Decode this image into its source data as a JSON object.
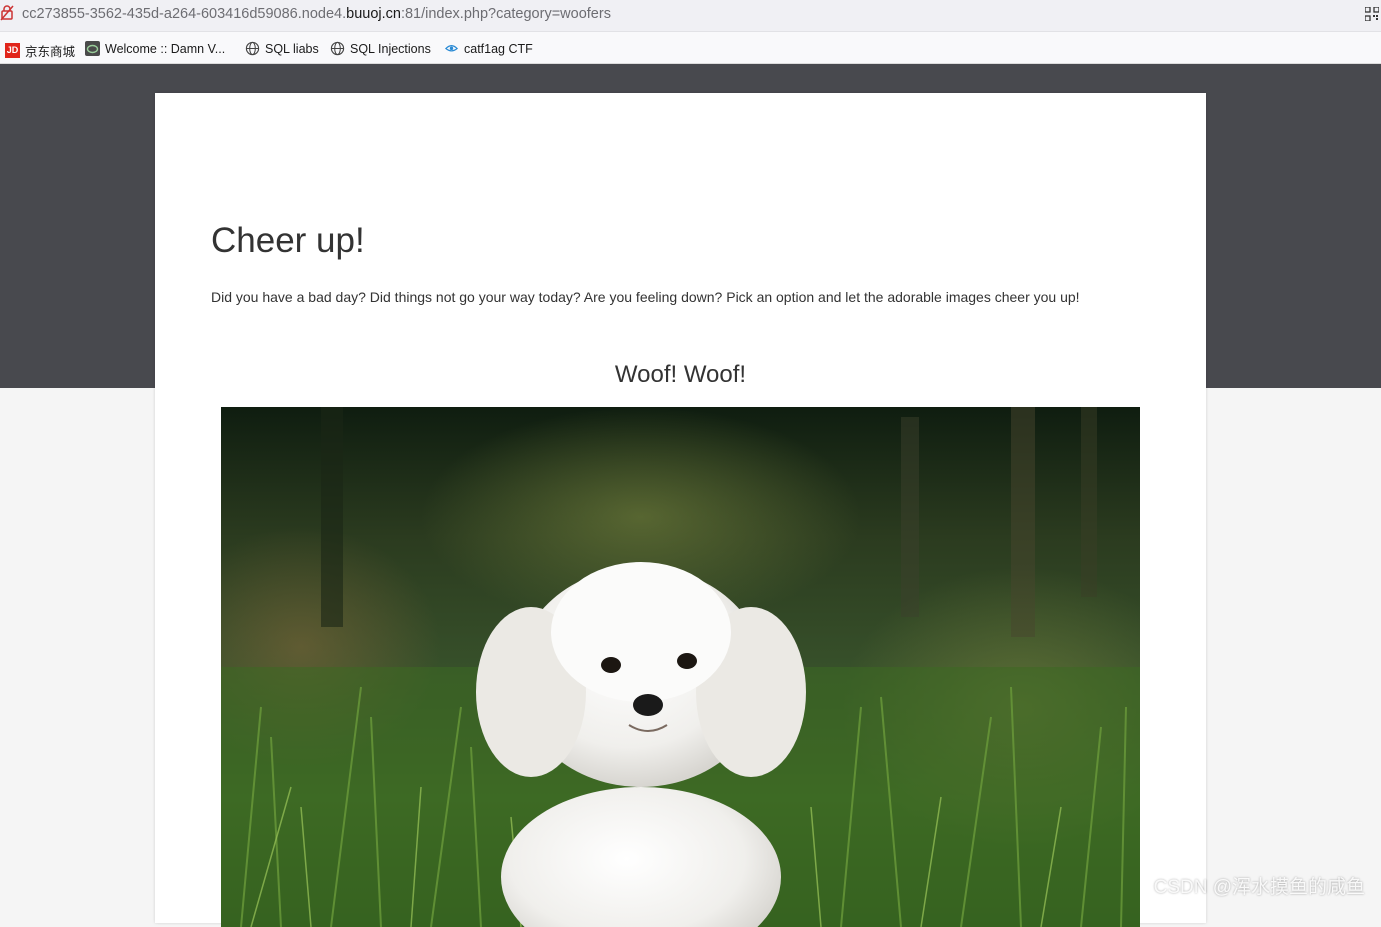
{
  "browser": {
    "url_prefix": "cc273855-3562-435d-a264-603416d59086.node4.",
    "url_host": "buuoj.cn",
    "url_suffix": ":81/index.php?category=woofers",
    "bookmarks": [
      {
        "label": "京东商城",
        "icon": "jd-icon"
      },
      {
        "label": "Welcome :: Damn V...",
        "icon": "dvwa-icon"
      },
      {
        "label": "SQL liabs",
        "icon": "globe-icon"
      },
      {
        "label": "SQL Injections",
        "icon": "globe-icon"
      },
      {
        "label": "catf1ag CTF",
        "icon": "eye-icon"
      }
    ]
  },
  "page": {
    "title": "Cheer up!",
    "intro": "Did you have a bad day? Did things not go your way today? Are you feeling down? Pick an option and let the adorable images cheer you up!",
    "section_heading": "Woof! Woof!",
    "image": "white-puppy-in-grass"
  },
  "watermark": "CSDN @浑水摸鱼的咸鱼",
  "colors": {
    "hero_bg": "#48494e",
    "page_bg": "#f5f5f5",
    "card_bg": "#ffffff"
  }
}
